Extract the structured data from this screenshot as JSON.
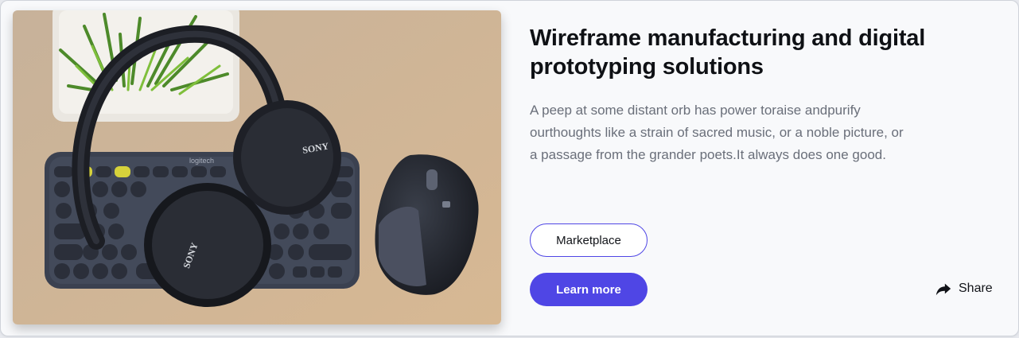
{
  "card": {
    "image": {
      "alt_icon": "product-photo",
      "keyboard_brand": "logitech",
      "headphone_brand": "SONY"
    },
    "title": "Wireframe manufacturing and digital prototyping solutions",
    "description": "A peep at some distant orb has power toraise andpurify ourthoughts like a strain of sacred music, or a noble picture, or a passage from the grander poets.It always does one good.",
    "buttons": {
      "marketplace_label": "Marketplace",
      "learn_more_label": "Learn more"
    },
    "share": {
      "label": "Share",
      "icon": "share-icon"
    }
  },
  "colors": {
    "accent": "#4f46e5",
    "title": "#0f1115",
    "description": "#6a6f7a",
    "card_background": "#f8f9fb"
  }
}
